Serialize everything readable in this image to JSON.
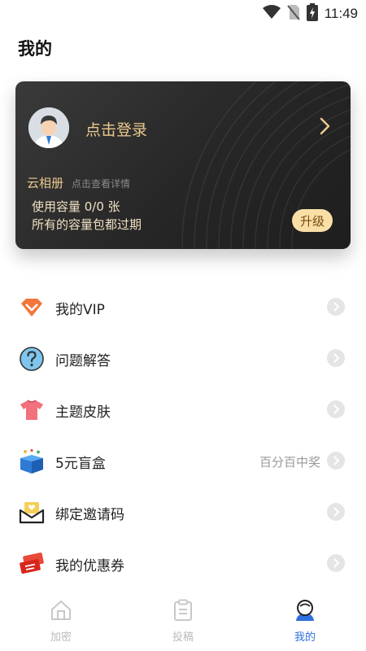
{
  "status_bar": {
    "time": "11:49",
    "icons": [
      "wifi-icon",
      "no-sim-icon",
      "battery-charging-icon"
    ]
  },
  "page": {
    "title": "我的"
  },
  "user_card": {
    "login_text": "点击登录",
    "cloud_title": "云相册",
    "cloud_hint": "点击查看详情",
    "usage_text": "使用容量  0/0  张",
    "expire_text": "所有的容量包都过期",
    "upgrade_label": "升级",
    "colors": {
      "card_bg": "#2a2a2a",
      "gold_text": "#ecc98f",
      "upgrade_bg": "#f9dfa6"
    }
  },
  "menu": {
    "items": [
      {
        "label": "我的VIP",
        "icon": "vip-diamond-icon",
        "extra": ""
      },
      {
        "label": "问题解答",
        "icon": "question-icon",
        "extra": ""
      },
      {
        "label": "主题皮肤",
        "icon": "tshirt-icon",
        "extra": ""
      },
      {
        "label": "5元盲盒",
        "icon": "gift-box-icon",
        "extra": "百分百中奖"
      },
      {
        "label": "绑定邀请码",
        "icon": "envelope-heart-icon",
        "extra": ""
      },
      {
        "label": "我的优惠券",
        "icon": "coupon-icon",
        "extra": ""
      }
    ]
  },
  "bottom_nav": {
    "items": [
      {
        "label": "加密",
        "icon": "home-icon",
        "active": false
      },
      {
        "label": "投稿",
        "icon": "clipboard-icon",
        "active": false
      },
      {
        "label": "我的",
        "icon": "profile-icon",
        "active": true
      }
    ],
    "active_color": "#2f6fe0"
  }
}
